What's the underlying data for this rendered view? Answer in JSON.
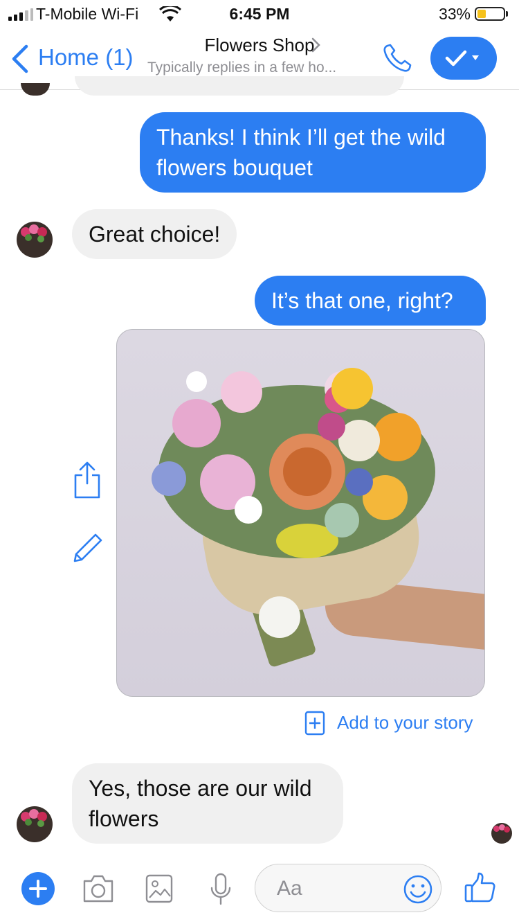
{
  "status_bar": {
    "carrier": "T-Mobile Wi-Fi",
    "time": "6:45 PM",
    "battery_percent": "33%",
    "battery_level": 0.33
  },
  "header": {
    "back_label": "Home (1)",
    "title": "Flowers Shop",
    "subtitle": "Typically replies in a few ho...",
    "accent_color": "#2c7ef2"
  },
  "messages": [
    {
      "sender": "me",
      "text": "Thanks! I think I’ll get the wild flowers bouquet"
    },
    {
      "sender": "shop",
      "text": "Great choice!"
    },
    {
      "sender": "me",
      "text": "It’s that one, right?"
    },
    {
      "sender": "me",
      "type": "photo",
      "subject": "wild flowers bouquet"
    },
    {
      "sender": "shop",
      "text": "Yes, those are our wild flowers"
    }
  ],
  "photo_actions": {
    "share_icon": "share-icon",
    "edit_icon": "pencil-icon",
    "add_story_label": "Add to your story"
  },
  "composer": {
    "placeholder": "Aa",
    "icons": [
      "plus-icon",
      "camera-icon",
      "image-icon",
      "microphone-icon",
      "emoji-icon",
      "thumbs-up-icon"
    ]
  }
}
